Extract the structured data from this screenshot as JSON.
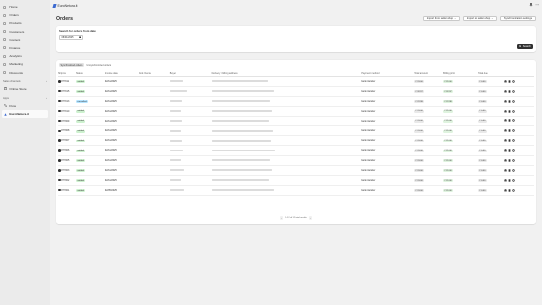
{
  "sidebar": {
    "items": [
      {
        "label": "Home",
        "icon": "home-icon"
      },
      {
        "label": "Orders",
        "icon": "orders-icon"
      },
      {
        "label": "Products",
        "icon": "tag-icon"
      },
      {
        "label": "Customers",
        "icon": "person-icon"
      },
      {
        "label": "Content",
        "icon": "content-icon"
      },
      {
        "label": "Finance",
        "icon": "finance-icon"
      },
      {
        "label": "Analytics",
        "icon": "chart-icon"
      },
      {
        "label": "Marketing",
        "icon": "target-icon"
      },
      {
        "label": "Discounts",
        "icon": "discount-icon"
      }
    ],
    "sales_channels_label": "Sales channels",
    "online_store": "Online Store",
    "apps_label": "Apps",
    "flow": "Flow",
    "app": "EuroNetura.it"
  },
  "topbar": {
    "title": "EuroNetura.it"
  },
  "page": {
    "title": "Orders",
    "buttons": [
      "Import from seller.shop",
      "Import to seller.shop",
      "Synchronization settings"
    ]
  },
  "search": {
    "label": "Search for orders from date",
    "date": "08/01/2025",
    "button": "Search"
  },
  "tabs": [
    "Synchronized orders",
    "Unsynchronized orders"
  ],
  "table": {
    "headers": [
      "Ship.ks",
      "Status",
      "Invoice date",
      "Cod. Dente",
      "Buyer",
      "Delivery / billing address",
      "Payment method",
      "Total amount",
      "Billing print",
      "Total due"
    ],
    "rows": [
      {
        "ship": "#77011",
        "status": "settled",
        "date": "02/11/2025",
        "payment": "bank transfer",
        "total": "€ 31.00",
        "print": "€ 31.00",
        "due": "€ 0.00"
      },
      {
        "ship": "#77015",
        "status": "settled",
        "date": "02/11/2025",
        "payment": "bank transfer",
        "total": "€ 32.97",
        "print": "€ 32.97",
        "due": "€ 0.00"
      },
      {
        "ship": "#77013",
        "status": "cancelled",
        "date": "02/11/2025",
        "payment": "bank transfer",
        "total": "€ 22.98",
        "print": "€ 22.98",
        "due": "€ 0.00"
      },
      {
        "ship": "#77010",
        "status": "settled",
        "date": "02/11/2025",
        "payment": "bank transfer",
        "total": "€ 31.00",
        "print": "€ 31.00",
        "due": "€ 0.00"
      },
      {
        "ship": "#77009",
        "status": "settled",
        "date": "02/11/2025",
        "payment": "bank transfer",
        "total": "€ 31.00",
        "print": "€ 31.00",
        "due": "€ 0.00"
      },
      {
        "ship": "#77008",
        "status": "settled",
        "date": "02/11/2025",
        "payment": "bank transfer",
        "total": "€ 31.00",
        "print": "€ 31.00",
        "due": "€ 0.00"
      },
      {
        "ship": "#77007",
        "status": "settled",
        "date": "02/11/2025",
        "payment": "bank transfer",
        "total": "€ 31.00",
        "print": "€ 31.00",
        "due": "€ 0.00"
      },
      {
        "ship": "#77006",
        "status": "settled",
        "date": "02/11/2025",
        "payment": "bank transfer",
        "total": "€ 31.00",
        "print": "€ 31.00",
        "due": "€ 0.00"
      },
      {
        "ship": "#77005",
        "status": "settled",
        "date": "02/11/2025",
        "payment": "bank transfer",
        "total": "€ 31.00",
        "print": "€ 31.00",
        "due": "€ 0.00"
      },
      {
        "ship": "#77003",
        "status": "settled",
        "date": "02/11/2025",
        "payment": "bank transfer",
        "total": "€ 31.00",
        "print": "€ 31.00",
        "due": "€ 0.00"
      },
      {
        "ship": "#77002",
        "status": "settled",
        "date": "02/11/2025",
        "payment": "bank transfer",
        "total": "€ 31.00",
        "print": "€ 31.00",
        "due": "€ 0.00"
      },
      {
        "ship": "#77001",
        "status": "settled",
        "date": "02/05/2025",
        "payment": "bank transfer",
        "total": "€ 31.00",
        "print": "€ 31.00",
        "due": "€ 0.00"
      }
    ]
  },
  "pagination": {
    "text": "1-12 di 12 total results"
  },
  "colors": {
    "settled_bg": "#cdf1cf",
    "cancelled_bg": "#b3e3ff",
    "total_bg": "#dff3df",
    "sidebar_bg": "#ebebeb",
    "page_bg": "#f1f1f1"
  }
}
